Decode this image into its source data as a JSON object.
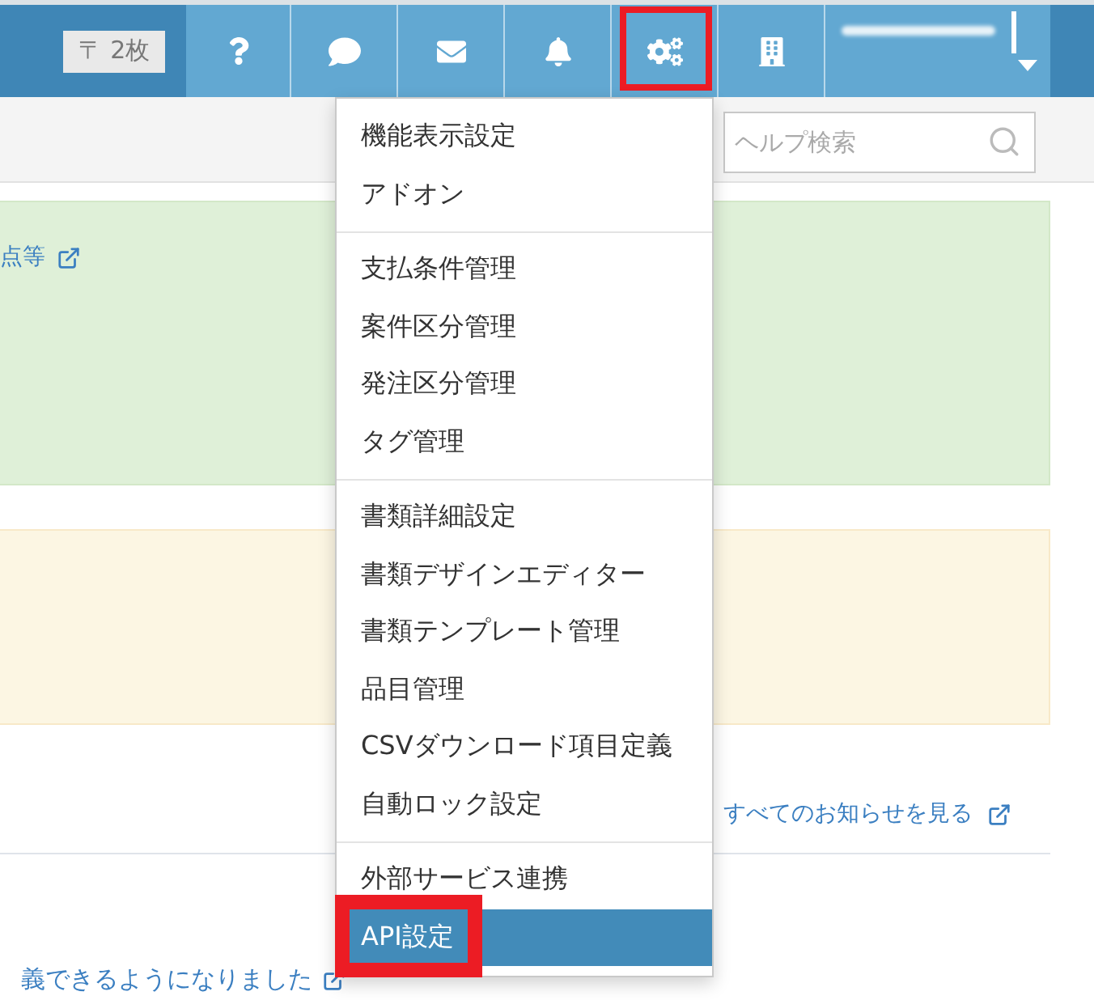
{
  "header": {
    "postal_badge": "〒 2枚"
  },
  "nav": [
    {
      "kind": "help",
      "marked": false
    },
    {
      "kind": "chat",
      "marked": false
    },
    {
      "kind": "mail",
      "marked": false
    },
    {
      "kind": "notifications",
      "marked": false
    },
    {
      "kind": "settings",
      "marked": true
    },
    {
      "kind": "office",
      "marked": false
    }
  ],
  "help_search": {
    "placeholder": "ヘルプ検索"
  },
  "notices": [
    {
      "kind": "success",
      "link": "点等"
    },
    {
      "kind": "warning"
    }
  ],
  "all_notices_link": "すべてのお知らせを見る",
  "news_link": "義できるようになりました",
  "settings_menu": {
    "groups": [
      [
        {
          "label": "機能表示設定",
          "selected": false,
          "marked": false
        },
        {
          "label": "アドオン",
          "selected": false,
          "marked": false
        }
      ],
      [
        {
          "label": "支払条件管理",
          "selected": false,
          "marked": false
        },
        {
          "label": "案件区分管理",
          "selected": false,
          "marked": false
        },
        {
          "label": "発注区分管理",
          "selected": false,
          "marked": false
        },
        {
          "label": "タグ管理",
          "selected": false,
          "marked": false
        }
      ],
      [
        {
          "label": "書類詳細設定",
          "selected": false,
          "marked": false
        },
        {
          "label": "書類デザインエディター",
          "selected": false,
          "marked": false
        },
        {
          "label": "書類テンプレート管理",
          "selected": false,
          "marked": false
        },
        {
          "label": "品目管理",
          "selected": false,
          "marked": false
        },
        {
          "label": "CSVダウンロード項目定義",
          "selected": false,
          "marked": false
        },
        {
          "label": "自動ロック設定",
          "selected": false,
          "marked": false
        }
      ],
      [
        {
          "label": "外部サービス連携",
          "selected": false,
          "marked": false
        },
        {
          "label": "API設定",
          "selected": true,
          "marked": true
        }
      ]
    ]
  }
}
